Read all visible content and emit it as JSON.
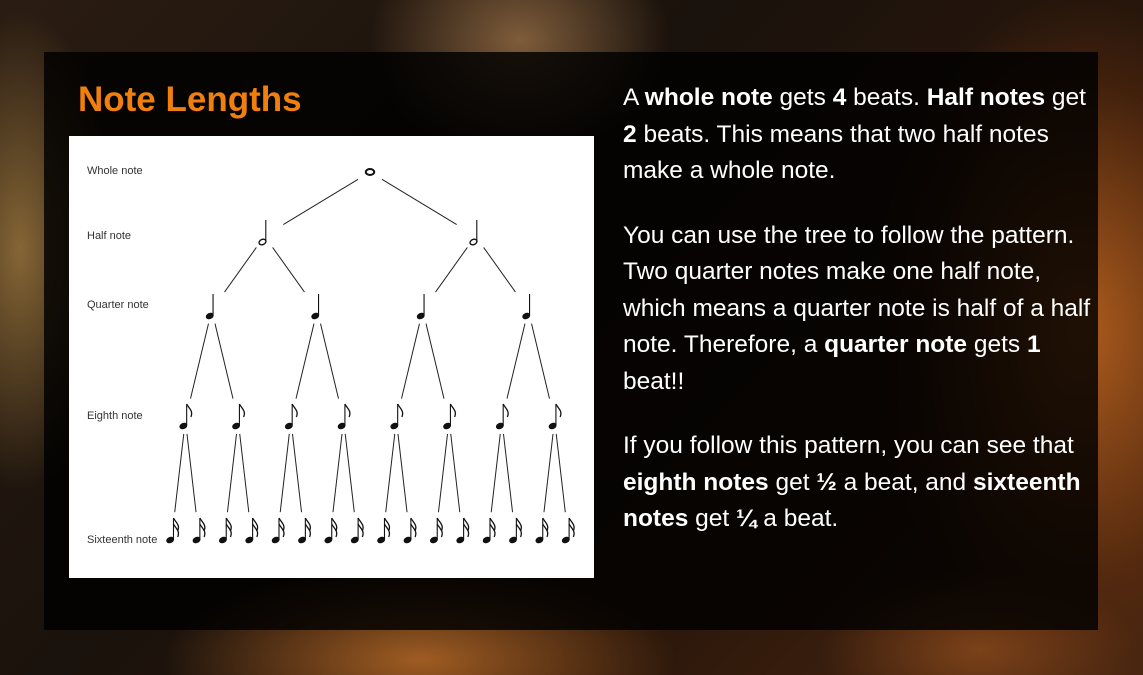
{
  "slide": {
    "title": "Note Lengths",
    "colors": {
      "title": "#f07f0e",
      "text": "#ffffff",
      "panel": "#000000"
    }
  },
  "diagram": {
    "rows": [
      {
        "label": "Whole note",
        "symbol": "whole-note"
      },
      {
        "label": "Half note",
        "symbol": "half-note"
      },
      {
        "label": "Quarter note",
        "symbol": "quarter-note"
      },
      {
        "label": "Eighth note",
        "symbol": "eighth-note"
      },
      {
        "label": "Sixteenth note",
        "symbol": "sixteenth-note"
      }
    ]
  },
  "body": {
    "p1": {
      "s1": "A ",
      "b1": "whole note",
      "s2": " gets ",
      "b2": "4",
      "s3": " beats. ",
      "b3": "Half notes",
      "s4": " get ",
      "b4": "2",
      "s5": " beats. This means that two half notes make a whole note."
    },
    "p2": {
      "s1": "You can use the tree to follow the pattern. Two quarter notes make one half note, which means a quarter note is half of a half note. Therefore, a ",
      "b1": "quarter note",
      "s2": "  gets ",
      "b2": "1",
      "s3": " beat!!"
    },
    "p3": {
      "s1": "If you follow this pattern, you can see that ",
      "b1": "eighth notes",
      "s2": " get ",
      "b2": "½",
      "s3": " a beat, and ",
      "b3": "sixteenth notes",
      "s4": " get ",
      "b4": "¼",
      "s5": " a beat."
    }
  }
}
